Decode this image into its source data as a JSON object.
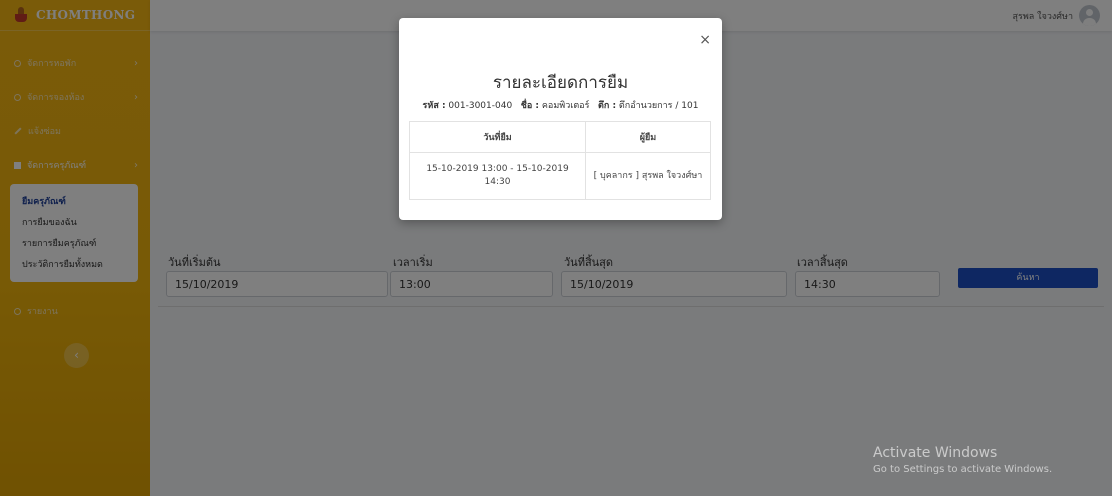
{
  "brand": {
    "name": "CHOMTHONG"
  },
  "topbar": {
    "user_name": "สุรพล ใจวงศ์ษา"
  },
  "sidebar": {
    "items": [
      {
        "label": "จัดการหอพัก"
      },
      {
        "label": "จัดการจองห้อง"
      },
      {
        "label": "แจ้งซ่อม"
      },
      {
        "label": "จัดการครุภัณฑ์"
      },
      {
        "label": "รายงาน"
      }
    ],
    "submenu": [
      {
        "label": "ยืมครุภัณฑ์"
      },
      {
        "label": "การยืมของฉัน"
      },
      {
        "label": "รายการยืมครุภัณฑ์"
      },
      {
        "label": "ประวัติการยืมทั้งหมด"
      }
    ]
  },
  "form": {
    "start_date_label": "วันที่เริ่มต้น",
    "start_date": "15/10/2019",
    "start_time_label": "เวลาเริ่ม",
    "start_time": "13:00",
    "end_date_label": "วันที่สิ้นสุด",
    "end_date": "15/10/2019",
    "end_time_label": "เวลาสิ้นสุด",
    "end_time": "14:30",
    "search_label": "ค้นหา"
  },
  "watermark": {
    "line1": "Activate Windows",
    "line2": "Go to Settings to activate Windows."
  },
  "modal": {
    "close": "×",
    "title": "รายละเอียดการยืม",
    "code_label": "รหัส :",
    "code": "001-3001-040",
    "name_label": "ชื่อ :",
    "name": "คอมพิวเตอร์",
    "building_label": "ตึก :",
    "building": "ตึกอำนวยการ / 101",
    "columns": [
      "วันที่ยืม",
      "ผู้ยืม"
    ],
    "rows": [
      [
        "15-10-2019 13:00 - 15-10-2019 14:30",
        "[ บุคลากร ] สุรพล ใจวงศ์ษา"
      ]
    ]
  }
}
